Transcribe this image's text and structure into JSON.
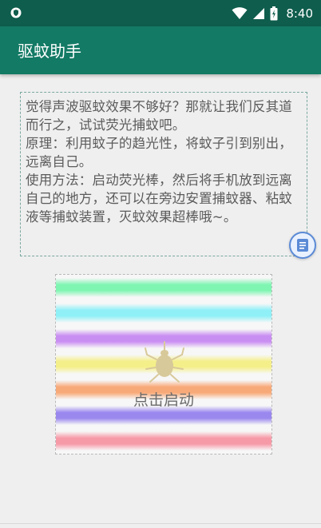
{
  "status_bar": {
    "time": "8:40",
    "left_icon": "shield-icon",
    "icons": [
      "wifi-icon",
      "signal-icon",
      "battery-icon"
    ]
  },
  "app_bar": {
    "title": "驱蚊助手",
    "color": "#137a65"
  },
  "info": {
    "lines": [
      "觉得声波驱蚊效果不够好？那就让我们反其道而行之，试试荧光捕蚊吧。",
      "原理：利用蚊子的趋光性，将蚊子引到别出，远离自己。",
      "使用方法：启动荧光棒，然后将手机放到远离自己的地方，还可以在旁边安置捕蚊器、粘蚊液等捕蚊装置，灭蚊效果超棒哦~。"
    ]
  },
  "float_button": {
    "icon": "document-icon"
  },
  "start_panel": {
    "label": "点击启动",
    "icon": "mosquito-icon",
    "stripe_colors": [
      "#7ff5b2",
      "#8ff0f7",
      "#c98ef2",
      "#f5ef8a",
      "#f8a978",
      "#9b88ee",
      "#f79aa7"
    ]
  }
}
